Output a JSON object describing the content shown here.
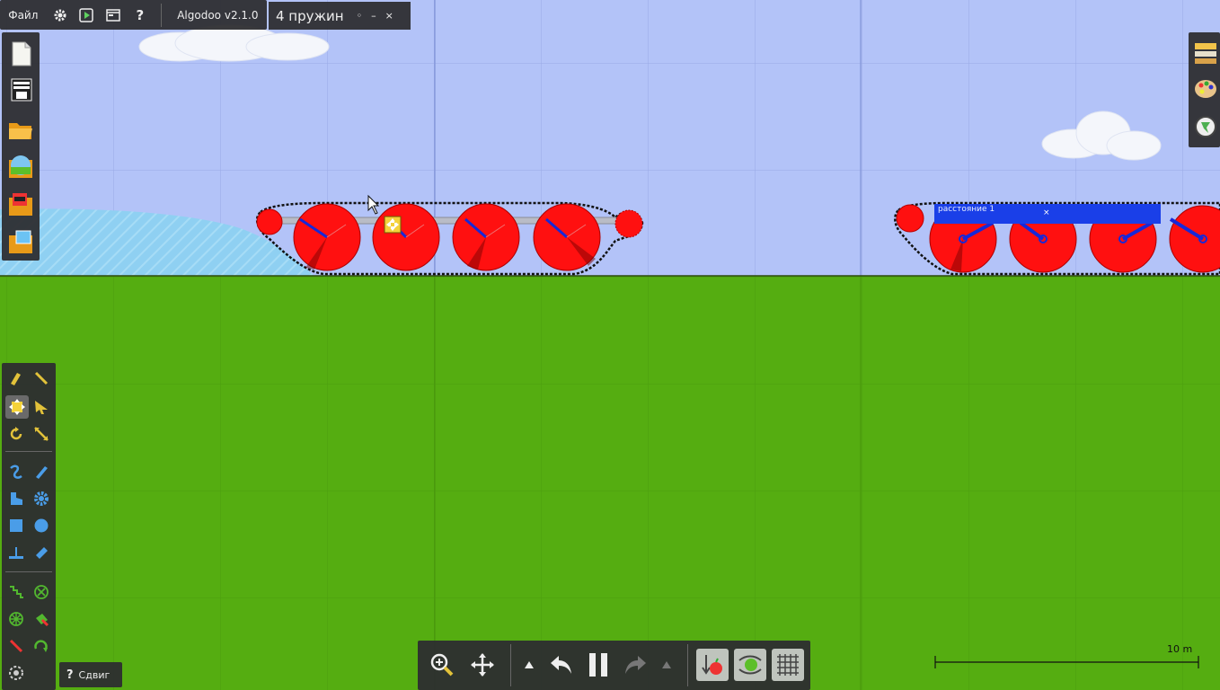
{
  "menu": {
    "file_label": "Файл",
    "app_name": "Algodoo v2.1.0",
    "doc_title": "4 пружин",
    "title_controls": [
      "◦",
      "–",
      "×"
    ]
  },
  "icons": {
    "top": [
      "gear-icon",
      "play-window-icon",
      "window-icon",
      "help-icon"
    ],
    "left_file": [
      "new-scene-icon",
      "scene-list-icon",
      "open-folder-icon",
      "theme-icon",
      "toys-icon",
      "pictures-icon"
    ],
    "right": [
      "materials-icon",
      "palette-icon",
      "visualization-icon"
    ]
  },
  "scene": {
    "attachment_label": "расстояние 1",
    "attachment_close": "×",
    "scale_label": "10 m",
    "colors": {
      "sky": "#b3c3f8",
      "ground": "#55ad11",
      "wheel": "#ff1010",
      "water": "#8fd0f2",
      "spring": "#1628d8"
    }
  },
  "tools_hint": {
    "label": "Сдвиг",
    "icon": "help-icon"
  },
  "bottom_bar": {
    "buttons": [
      "zoom-icon",
      "pan-icon",
      "undo-arrow-up-icon",
      "undo-icon",
      "pause-icon",
      "redo-icon",
      "redo-arrow-down-icon",
      "gravity-icon",
      "air-friction-icon",
      "grid-icon"
    ]
  }
}
